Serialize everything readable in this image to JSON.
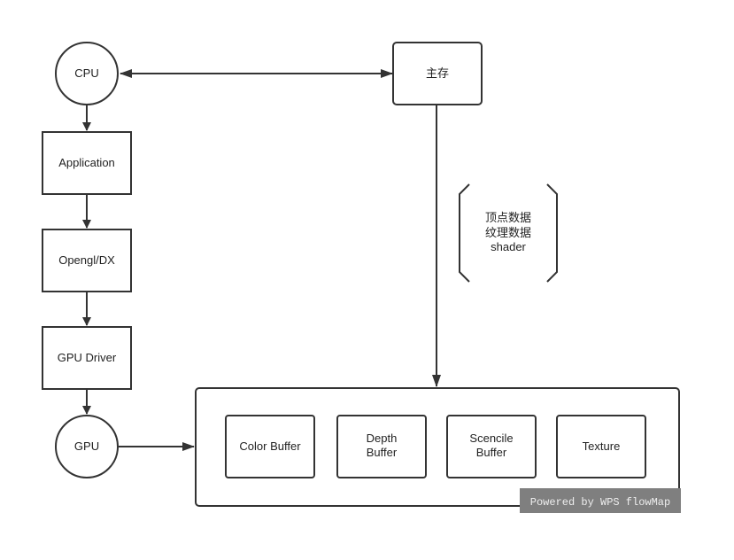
{
  "nodes": {
    "cpu": "CPU",
    "main_memory": "主存",
    "application": "Application",
    "opengl": "Opengl/DX",
    "gpu_driver": "GPU Driver",
    "gpu": "GPU",
    "color_buffer": "Color Buffer",
    "depth_buffer": [
      "Depth",
      "Buffer"
    ],
    "stencil_buffer": [
      "Scencile",
      "Buffer"
    ],
    "texture": "Texture"
  },
  "annotation": [
    "顶点数据",
    "纹理数据",
    "shader"
  ],
  "watermark": "Powered by WPS flowMap",
  "colors": {
    "stroke": "#333333",
    "watermark_bg": "#7f7f7f"
  }
}
